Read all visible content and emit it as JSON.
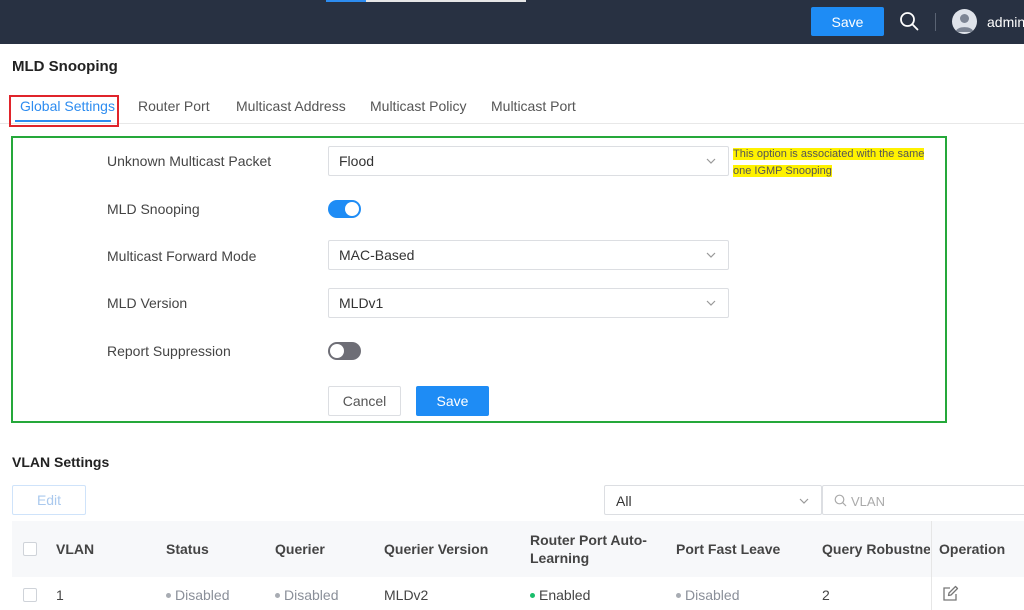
{
  "header": {
    "save_label": "Save",
    "user_name": "admin",
    "progress_percent": 20,
    "icons": {
      "search": "search-icon",
      "avatar": "user-avatar-icon"
    }
  },
  "page": {
    "title": "MLD Snooping"
  },
  "tabs": [
    {
      "label": "Global Settings",
      "active": true
    },
    {
      "label": "Router Port",
      "active": false
    },
    {
      "label": "Multicast Address",
      "active": false
    },
    {
      "label": "Multicast Policy",
      "active": false
    },
    {
      "label": "Multicast Port",
      "active": false
    }
  ],
  "form": {
    "unknown_multicast_packet": {
      "label": "Unknown Multicast Packet",
      "value": "Flood"
    },
    "note": {
      "line1": "This option is associated with the same",
      "line2": "one IGMP Snooping"
    },
    "mld_snooping": {
      "label": "MLD Snooping",
      "enabled": true
    },
    "multicast_forward_mode": {
      "label": "Multicast Forward Mode",
      "value": "MAC-Based"
    },
    "mld_version": {
      "label": "MLD Version",
      "value": "MLDv1"
    },
    "report_suppression": {
      "label": "Report Suppression",
      "enabled": false
    },
    "cancel_label": "Cancel",
    "save_label": "Save"
  },
  "vlan_settings": {
    "title": "VLAN Settings",
    "edit_label": "Edit",
    "filter_value": "All",
    "search_placeholder": "VLAN",
    "columns": {
      "vlan": "VLAN",
      "status": "Status",
      "querier": "Querier",
      "querier_version": "Querier Version",
      "router_port_auto_learning_1": "Router Port Auto-",
      "router_port_auto_learning_2": "Learning",
      "port_fast_leave": "Port Fast Leave",
      "query_robustness": "Query Robustnes",
      "operation": "Operation"
    },
    "rows": [
      {
        "vlan": "1",
        "status": "Disabled",
        "querier": "Disabled",
        "querier_version": "MLDv2",
        "router_port_auto_learning": "Enabled",
        "port_fast_leave": "Disabled",
        "query_robustness": "2"
      }
    ]
  },
  "colors": {
    "primary": "#1e8cf5",
    "topbar": "#283142",
    "enabled_dot": "#19be6b",
    "disabled_dot": "#a8acb3",
    "highlight_red": "#e0242b",
    "highlight_green": "#25a83a",
    "note_highlight": "#fff200"
  }
}
